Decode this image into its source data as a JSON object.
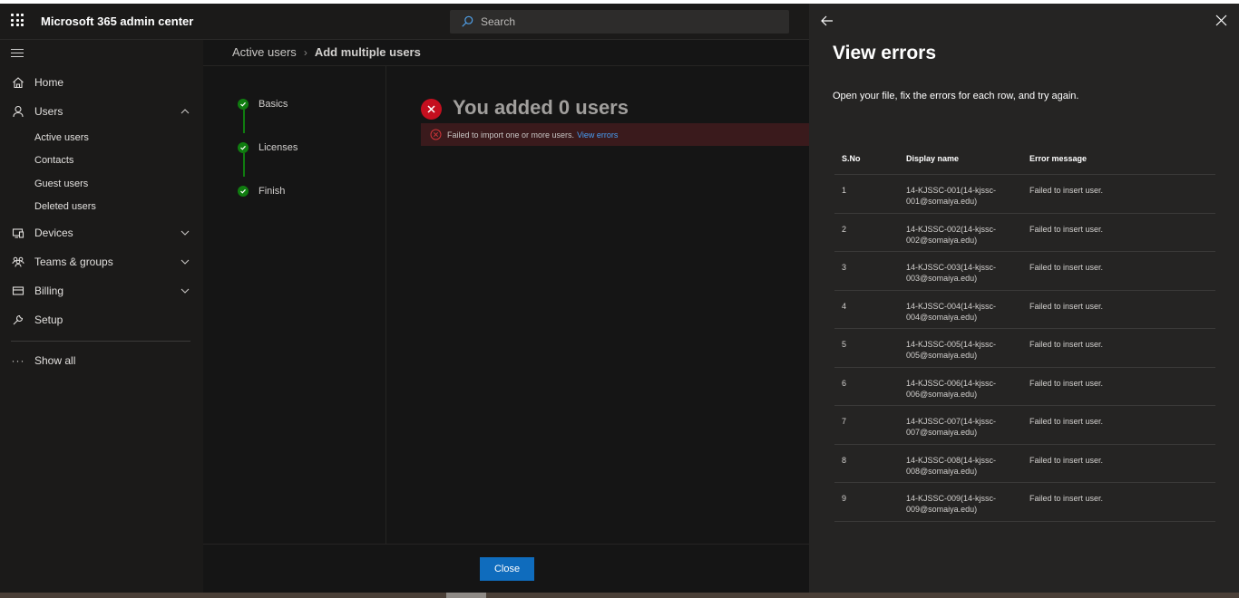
{
  "app": {
    "title": "Microsoft 365 admin center"
  },
  "search": {
    "placeholder": "Search"
  },
  "sidebar": {
    "items": [
      {
        "label": "Home",
        "icon": "home-icon"
      },
      {
        "label": "Users",
        "icon": "person-icon",
        "expanded": true
      },
      {
        "label": "Devices",
        "icon": "devices-icon"
      },
      {
        "label": "Teams & groups",
        "icon": "people-icon"
      },
      {
        "label": "Billing",
        "icon": "billing-icon"
      },
      {
        "label": "Setup",
        "icon": "wrench-icon"
      }
    ],
    "users_sub": [
      "Active users",
      "Contacts",
      "Guest users",
      "Deleted users"
    ],
    "show_all": "Show all"
  },
  "breadcrumb": {
    "parent": "Active users",
    "current": "Add multiple users"
  },
  "steps": [
    "Basics",
    "Licenses",
    "Finish"
  ],
  "result": {
    "title": "You added 0 users",
    "error_text": "Failed to import one or more users.",
    "error_link": "View errors"
  },
  "footer": {
    "close_label": "Close"
  },
  "panel": {
    "title": "View errors",
    "description": "Open your file, fix the errors for each row, and try again.",
    "columns": [
      "S.No",
      "Display name",
      "Error message"
    ],
    "rows": [
      {
        "sno": "1",
        "name": "14-KJSSC-001(14-kjssc-001@somaiya.edu)",
        "error": "Failed to insert user."
      },
      {
        "sno": "2",
        "name": "14-KJSSC-002(14-kjssc-002@somaiya.edu)",
        "error": "Failed to insert user."
      },
      {
        "sno": "3",
        "name": "14-KJSSC-003(14-kjssc-003@somaiya.edu)",
        "error": "Failed to insert user."
      },
      {
        "sno": "4",
        "name": "14-KJSSC-004(14-kjssc-004@somaiya.edu)",
        "error": "Failed to insert user."
      },
      {
        "sno": "5",
        "name": "14-KJSSC-005(14-kjssc-005@somaiya.edu)",
        "error": "Failed to insert user."
      },
      {
        "sno": "6",
        "name": "14-KJSSC-006(14-kjssc-006@somaiya.edu)",
        "error": "Failed to insert user."
      },
      {
        "sno": "7",
        "name": "14-KJSSC-007(14-kjssc-007@somaiya.edu)",
        "error": "Failed to insert user."
      },
      {
        "sno": "8",
        "name": "14-KJSSC-008(14-kjssc-008@somaiya.edu)",
        "error": "Failed to insert user."
      },
      {
        "sno": "9",
        "name": "14-KJSSC-009(14-kjssc-009@somaiya.edu)",
        "error": "Failed to insert user."
      }
    ]
  },
  "colors": {
    "accent": "#0f6cbd",
    "success": "#107c10",
    "error": "#c50f1f",
    "link": "#479ef5"
  }
}
